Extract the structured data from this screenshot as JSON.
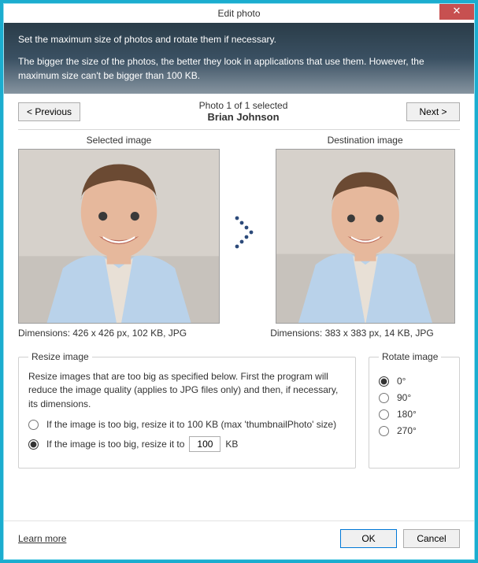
{
  "window": {
    "title": "Edit photo"
  },
  "banner": {
    "line1": "Set the maximum size of photos and rotate them if necessary.",
    "line2": "The bigger the size of the photos, the better they look in applications that use them. However, the maximum size can't be bigger than 100 KB."
  },
  "nav": {
    "prev": "<  Previous",
    "next": "Next  >",
    "counter": "Photo 1 of 1 selected",
    "name": "Brian Johnson"
  },
  "compare": {
    "left_label": "Selected image",
    "right_label": "Destination image",
    "left_dims": "Dimensions: 426 x 426 px, 102 KB, JPG",
    "right_dims": "Dimensions: 383 x 383 px, 14 KB, JPG"
  },
  "resize": {
    "legend": "Resize image",
    "desc": "Resize images that are too big as specified below. First the program will reduce the image quality (applies to JPG files only) and then, if necessary, its dimensions.",
    "opt1": "If the image is too big, resize it to 100 KB (max 'thumbnailPhoto' size)",
    "opt2_prefix": "If the image is too big, resize it to",
    "opt2_value": "100",
    "opt2_suffix": "KB",
    "selected": "opt2"
  },
  "rotate": {
    "legend": "Rotate image",
    "options": [
      "0°",
      "90°",
      "180°",
      "270°"
    ],
    "selected": 0
  },
  "footer": {
    "learn": "Learn more",
    "ok": "OK",
    "cancel": "Cancel"
  }
}
